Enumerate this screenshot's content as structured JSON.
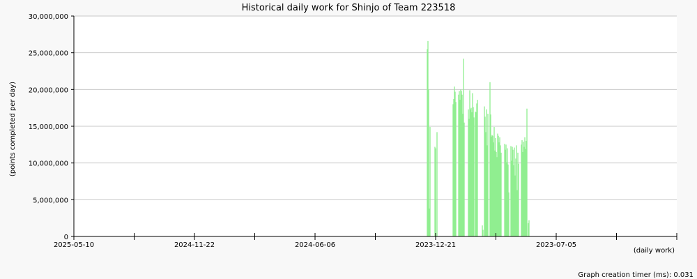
{
  "chart_data": {
    "type": "bar",
    "title": "Historical daily work for Shinjo of Team 223518",
    "ylabel": "(points completed per day)",
    "xlabel": "(daily work)",
    "ylim": [
      0,
      30000000
    ],
    "y_ticks": [
      "0",
      "5,000,000",
      "10,000,000",
      "15,000,000",
      "20,000,000",
      "25,000,000",
      "30,000,000"
    ],
    "x_ticks": [
      "2025-05-10",
      "2024-11-22",
      "2024-06-06",
      "2023-12-21",
      "2023-07-05"
    ],
    "x_order": "descending-date",
    "grid": true,
    "bar_color": "#90ee90",
    "series": [
      {
        "values": [
          [
            -12,
            25500000
          ],
          [
            -11,
            26600000
          ],
          [
            -10,
            20000000
          ],
          [
            -9,
            3800000
          ],
          [
            -8,
            14900000
          ],
          [
            -1,
            12200000
          ],
          [
            0,
            12000000
          ],
          [
            2,
            14200000
          ],
          [
            25,
            18000000
          ],
          [
            26,
            18700000
          ],
          [
            27,
            20400000
          ],
          [
            28,
            19700000
          ],
          [
            29,
            18300000
          ],
          [
            33,
            19300000
          ],
          [
            34,
            19800000
          ],
          [
            35,
            18600000
          ],
          [
            36,
            20000000
          ],
          [
            37,
            19800000
          ],
          [
            38,
            19300000
          ],
          [
            39,
            16700000
          ],
          [
            40,
            24200000
          ],
          [
            41,
            15500000
          ],
          [
            47,
            17300000
          ],
          [
            48,
            16000000
          ],
          [
            49,
            19900000
          ],
          [
            50,
            17300000
          ],
          [
            51,
            17500000
          ],
          [
            52,
            16900000
          ],
          [
            53,
            19500000
          ],
          [
            54,
            17600000
          ],
          [
            55,
            16200000
          ],
          [
            57,
            17000000
          ],
          [
            58,
            16900000
          ],
          [
            59,
            18100000
          ],
          [
            60,
            18600000
          ],
          [
            67,
            1500000
          ],
          [
            68,
            900000
          ],
          [
            70,
            17700000
          ],
          [
            71,
            16300000
          ],
          [
            72,
            14200000
          ],
          [
            73,
            17300000
          ],
          [
            74,
            12400000
          ],
          [
            75,
            16700000
          ],
          [
            78,
            21000000
          ],
          [
            79,
            16600000
          ],
          [
            80,
            13600000
          ],
          [
            81,
            13800000
          ],
          [
            82,
            13700000
          ],
          [
            83,
            12800000
          ],
          [
            84,
            14900000
          ],
          [
            85,
            11700000
          ],
          [
            86,
            13400000
          ],
          [
            87,
            11500000
          ],
          [
            88,
            10800000
          ],
          [
            89,
            14000000
          ],
          [
            90,
            13700000
          ],
          [
            91,
            12800000
          ],
          [
            92,
            13500000
          ],
          [
            93,
            12400000
          ],
          [
            94,
            11400000
          ],
          [
            99,
            12600000
          ],
          [
            100,
            11800000
          ],
          [
            101,
            12500000
          ],
          [
            102,
            10100000
          ],
          [
            103,
            12000000
          ],
          [
            104,
            9800000
          ],
          [
            105,
            6000000
          ],
          [
            108,
            12300000
          ],
          [
            109,
            10300000
          ],
          [
            110,
            12200000
          ],
          [
            111,
            11800000
          ],
          [
            112,
            9700000
          ],
          [
            113,
            12100000
          ],
          [
            114,
            8300000
          ],
          [
            115,
            10600000
          ],
          [
            116,
            12400000
          ],
          [
            117,
            6300000
          ],
          [
            118,
            11400000
          ],
          [
            119,
            9900000
          ],
          [
            123,
            12500000
          ],
          [
            124,
            13100000
          ],
          [
            125,
            11500000
          ],
          [
            126,
            12900000
          ],
          [
            127,
            12200000
          ],
          [
            128,
            13500000
          ],
          [
            129,
            11900000
          ],
          [
            130,
            13000000
          ],
          [
            131,
            17400000
          ],
          [
            133,
            1800000
          ],
          [
            134,
            2200000
          ]
        ]
      }
    ]
  },
  "footer": {
    "timer_text": "Graph creation timer (ms): 0.031"
  }
}
